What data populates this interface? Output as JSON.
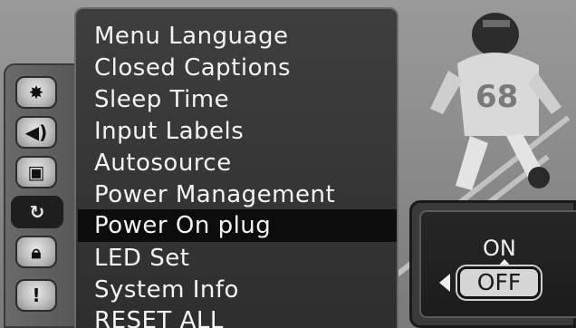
{
  "rail": {
    "icons": [
      {
        "name": "picture-settings-icon",
        "glyph": "✸"
      },
      {
        "name": "audio-speaker-icon",
        "glyph": "◀)"
      },
      {
        "name": "tv-channel-icon",
        "glyph": "▣"
      },
      {
        "name": "setup-features-icon",
        "glyph": "↻"
      },
      {
        "name": "lock-icon",
        "glyph": "🔒︎"
      },
      {
        "name": "alert-info-icon",
        "glyph": "!"
      }
    ],
    "active_index": 3
  },
  "menu": {
    "items": [
      "Menu Language",
      "Closed Captions",
      "Sleep Time",
      "Input Labels",
      "Autosource",
      "Power Management",
      "Power On plug",
      "LED Set",
      "System Info",
      "RESET ALL"
    ],
    "selected_index": 6
  },
  "option": {
    "on_label": "ON",
    "off_label": "OFF",
    "current": "OFF"
  },
  "colors": {
    "menu_bg": "#3a3a3a",
    "selected_bg": "#0c0c0c",
    "text": "#f4f4f4"
  }
}
